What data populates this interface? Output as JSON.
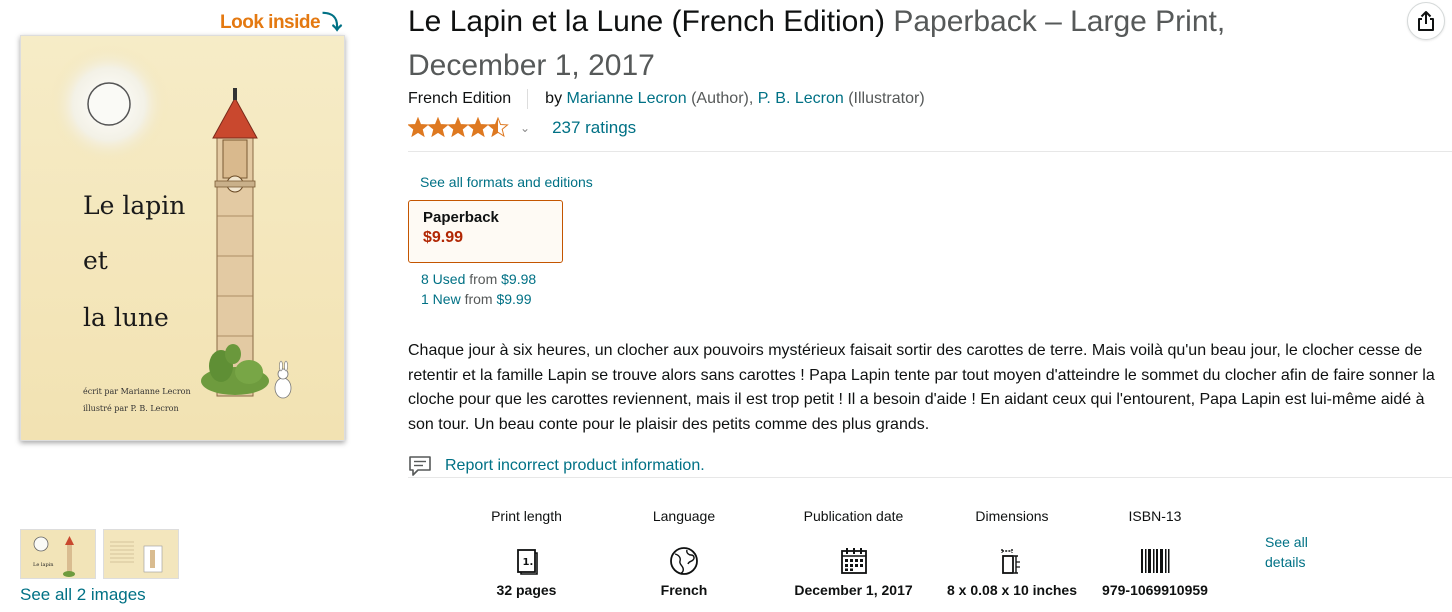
{
  "gallery": {
    "look_inside": "Look inside",
    "cover_text": [
      "Le lapin",
      "et",
      "la lune"
    ],
    "cover_credits": [
      "écrit par Marianne Lecron",
      "illustré par P. B. Lecron"
    ],
    "thumb_text": "Le lapin",
    "see_all_images": "See all 2 images"
  },
  "product": {
    "title": "Le Lapin et la Lune (French Edition)",
    "subtitle": "Paperback – Large Print, December 1, 2017",
    "edition": "French Edition",
    "by": "by",
    "author": "Marianne Lecron",
    "author_role": "(Author),",
    "illustrator": "P. B. Lecron",
    "illustrator_role": "(Illustrator)",
    "rating_value": 4.5,
    "ratings_count": "237 ratings"
  },
  "formats": {
    "link": "See all formats and editions",
    "selected": {
      "name": "Paperback",
      "price": "$9.99"
    },
    "used_link": "8 Used",
    "used_from": "from",
    "used_price": "$9.98",
    "new_link": "1 New",
    "new_from": "from",
    "new_price": "$9.99"
  },
  "description": "Chaque jour à six heures, un clocher aux pouvoirs mystérieux faisait sortir des carottes de terre. Mais voilà qu'un beau jour, le clocher cesse de retentir et la famille Lapin se trouve alors sans carottes ! Papa Lapin tente par tout moyen d'atteindre le sommet du clocher afin de faire sonner la cloche pour que les carottes reviennent, mais il est trop petit ! Il a besoin d'aide ! En aidant ceux qui l'entourent, Papa Lapin est lui-même aidé à son tour. Un beau conte pour le plaisir des petits comme des plus grands.",
  "report_link": "Report incorrect product information.",
  "details": [
    {
      "label": "Print length",
      "icon": "book-pages-icon",
      "value": "32 pages"
    },
    {
      "label": "Language",
      "icon": "globe-icon",
      "value": "French"
    },
    {
      "label": "Publication date",
      "icon": "calendar-icon",
      "value": "December 1, 2017"
    },
    {
      "label": "Dimensions",
      "icon": "dimensions-icon",
      "value": "8 x 0.08 x 10 inches"
    },
    {
      "label": "ISBN-13",
      "icon": "barcode-icon",
      "value": "979-1069910959"
    }
  ],
  "see_all_details": "See all details",
  "colors": {
    "link": "#007185",
    "price": "#b12704",
    "star": "#de7921",
    "look_inside": "#e47911"
  }
}
